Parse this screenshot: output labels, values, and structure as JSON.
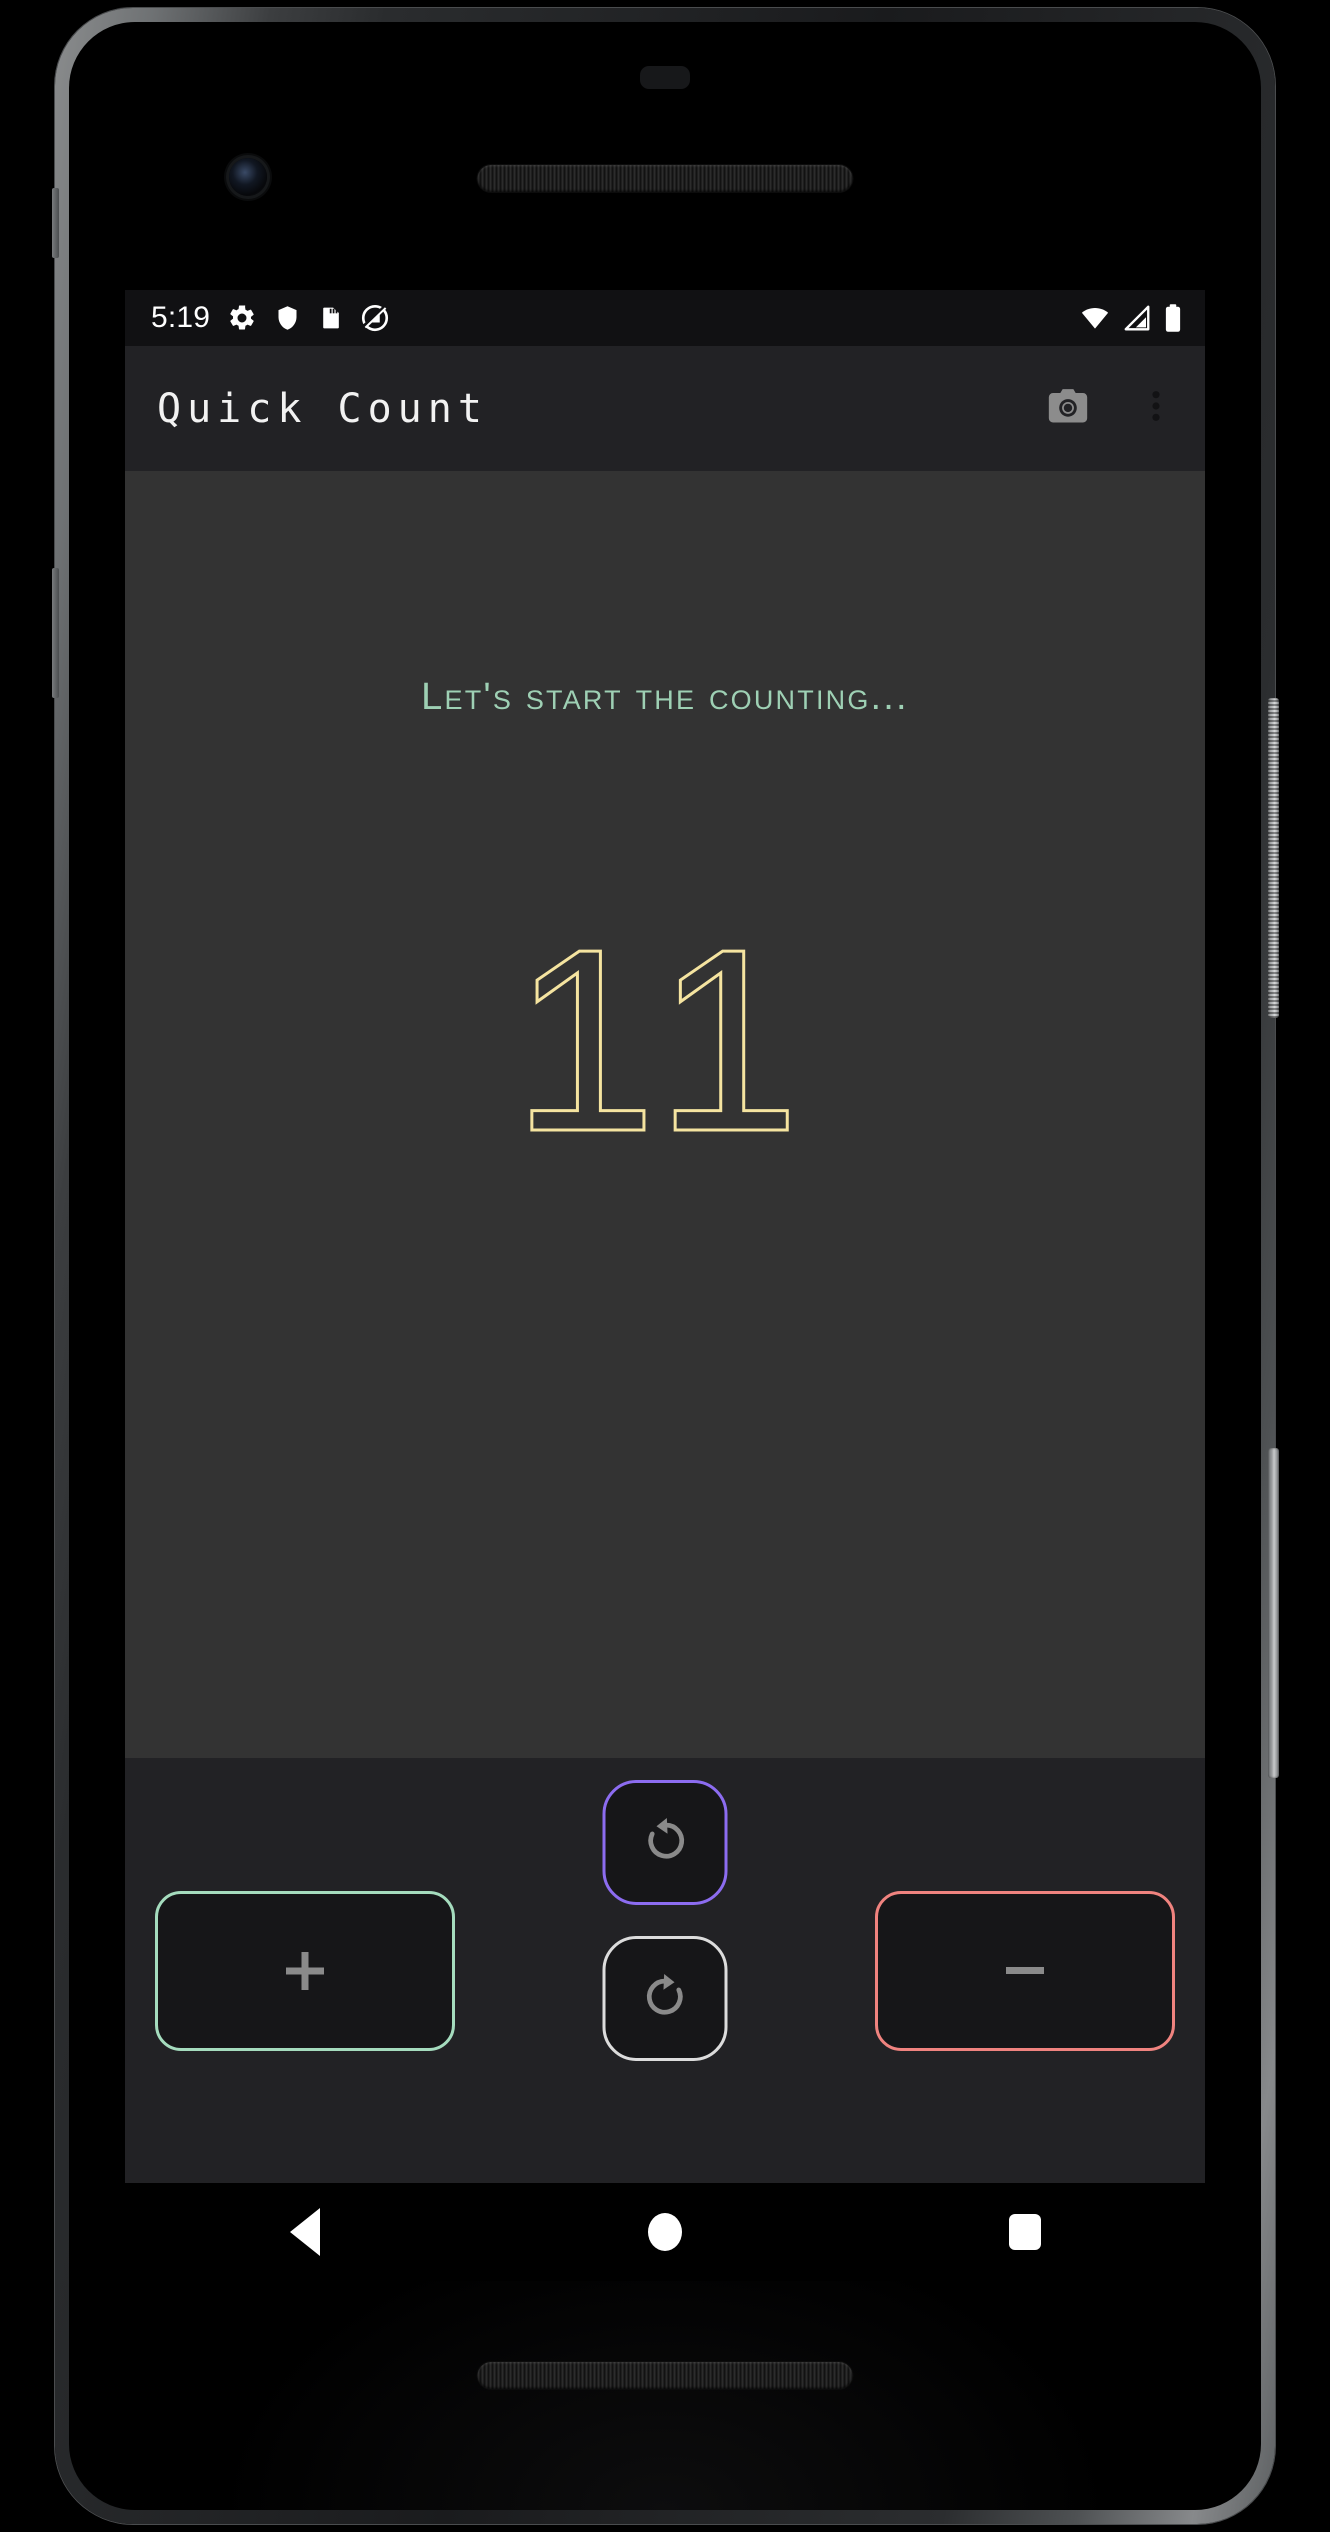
{
  "device": {
    "hardware": {
      "front_camera": "front-camera",
      "earpiece": "earpiece-speaker-grille",
      "bottom_speaker": "bottom-speaker-grille",
      "power_button": "power-button",
      "volume_button": "volume-rocker"
    }
  },
  "status_bar": {
    "clock": "5:19",
    "left_icons": [
      "settings-gear-icon",
      "shield-icon",
      "sd-card-icon",
      "android-q-logo-icon"
    ],
    "right_icons": [
      "wifi-icon",
      "cellular-signal-icon",
      "battery-icon"
    ],
    "background": "#111113",
    "foreground": "#ffffff"
  },
  "app_bar": {
    "title": "Quick Count",
    "background": "#222225",
    "title_color": "#f2f2f2",
    "actions": [
      {
        "name": "camera-button",
        "icon": "camera-icon",
        "color": "#8c8c8c"
      },
      {
        "name": "overflow-menu-button",
        "icon": "more-vertical-icon",
        "color": "#121212"
      }
    ]
  },
  "content": {
    "headline": "Let's start the counting...",
    "headline_color": "#9ed0b4",
    "counter_value": "11",
    "counter_outline_color": "#f5e4a0",
    "background": "#333333"
  },
  "button_panel": {
    "background": "#222225",
    "increment": {
      "label": "+",
      "icon": "plus-icon",
      "border_color": "#a5dcbe",
      "fill": "#161618",
      "glyph_color": "#8a8a8a"
    },
    "decrement": {
      "label": "−",
      "icon": "minus-icon",
      "border_color": "#f0837f",
      "fill": "#161618",
      "glyph_color": "#8a8a8a"
    },
    "undo": {
      "icon": "undo-rotate-left-icon",
      "border_color": "#8c6cf0",
      "fill": "#161618",
      "glyph_color": "#8a8a8a"
    },
    "redo": {
      "icon": "redo-rotate-right-icon",
      "border_color": "#dcdcdc",
      "fill": "#161618",
      "glyph_color": "#8a8a8a"
    }
  },
  "nav_bar": {
    "background": "#000000",
    "buttons": [
      {
        "name": "nav-back-button",
        "icon": "back-triangle-icon"
      },
      {
        "name": "nav-home-button",
        "icon": "home-circle-icon"
      },
      {
        "name": "nav-recents-button",
        "icon": "recents-square-icon"
      }
    ]
  }
}
